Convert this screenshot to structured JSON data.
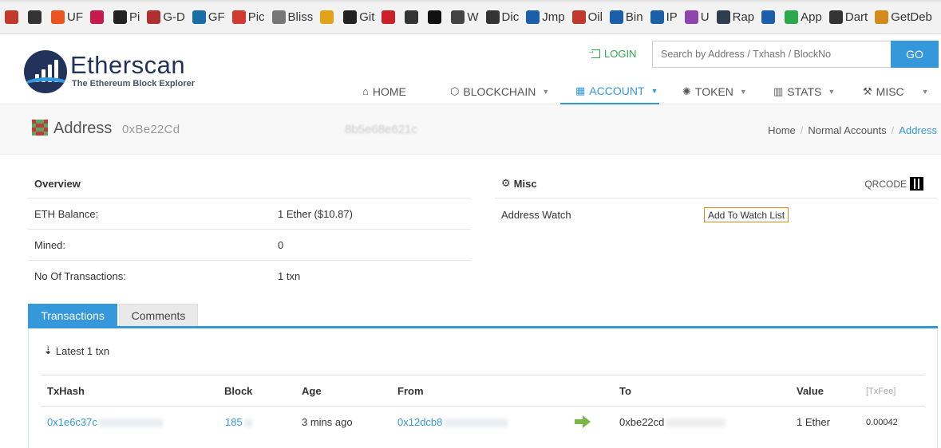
{
  "bookmarks": [
    {
      "label": "",
      "icon": "grid-icon",
      "color": "#c0392b"
    },
    {
      "label": "",
      "icon": "face-icon",
      "color": "#333333"
    },
    {
      "label": "UF",
      "icon": "ubuntu-icon",
      "color": "#e95420"
    },
    {
      "label": "",
      "icon": "raspberry-icon",
      "color": "#c51a4a"
    },
    {
      "label": "Pi",
      "icon": "penguin-icon",
      "color": "#222222"
    },
    {
      "label": "G-D",
      "icon": "book-icon",
      "color": "#b03030"
    },
    {
      "label": "GF",
      "icon": "tiki-icon",
      "color": "#1a6ea8"
    },
    {
      "label": "Pic",
      "icon": "pic-icon",
      "color": "#d03a2f"
    },
    {
      "label": "Bliss",
      "icon": "globe-icon",
      "color": "#777777"
    },
    {
      "label": "",
      "icon": "lp-icon",
      "color": "#e3a21a"
    },
    {
      "label": "Git",
      "icon": "github-icon",
      "color": "#222222"
    },
    {
      "label": "",
      "icon": "pinterest-icon",
      "color": "#cb2027"
    },
    {
      "label": "",
      "icon": "bbc-icon",
      "color": "#333333"
    },
    {
      "label": "",
      "icon": "rt-icon",
      "color": "#111111"
    },
    {
      "label": "W",
      "icon": "wiki-icon",
      "color": "#444444"
    },
    {
      "label": "Dic",
      "icon": "dict-icon",
      "color": "#333333"
    },
    {
      "label": "Jmp",
      "icon": "jump-icon",
      "color": "#1a5fa8"
    },
    {
      "label": "Oil",
      "icon": "oil-icon",
      "color": "#c0392b"
    },
    {
      "label": "Bin",
      "icon": "bin-icon",
      "color": "#1a5fa8"
    },
    {
      "label": "IP",
      "icon": "ip-icon",
      "color": "#1a5fa8"
    },
    {
      "label": "U",
      "icon": "plus-icon",
      "color": "#8e44ad"
    },
    {
      "label": "Rap",
      "icon": "rap-icon",
      "color": "#2c3e50"
    },
    {
      "label": "",
      "icon": "ht-icon",
      "color": "#1a5fa8"
    },
    {
      "label": "App",
      "icon": "play-icon",
      "color": "#2ba84a"
    },
    {
      "label": "Dart",
      "icon": "dart-icon",
      "color": "#333333"
    },
    {
      "label": "GetDeb",
      "icon": "box-icon",
      "color": "#d28a1a"
    }
  ],
  "header": {
    "logo_title": "Etherscan",
    "logo_subtitle": "The Ethereum Block Explorer",
    "login_label": "LOGIN",
    "search_placeholder": "Search by Address / Txhash / BlockNo",
    "go_label": "GO",
    "nav": [
      {
        "label": "HOME",
        "icon": "home-icon"
      },
      {
        "label": "BLOCKCHAIN",
        "icon": "cube-icon"
      },
      {
        "label": "ACCOUNT",
        "icon": "grid-icon"
      },
      {
        "label": "TOKEN",
        "icon": "token-icon"
      },
      {
        "label": "STATS",
        "icon": "chart-icon"
      },
      {
        "label": "MISC",
        "icon": "wrench-icon"
      }
    ]
  },
  "page": {
    "title": "Address",
    "address_prefix": "0xBe22Cd",
    "address_suffix": "8b5e68e621c",
    "breadcrumb": [
      "Home",
      "Normal Accounts",
      "Address"
    ]
  },
  "overview": {
    "heading": "Overview",
    "rows": [
      {
        "key": "ETH Balance:",
        "value": "1 Ether ($10.87)"
      },
      {
        "key": "Mined:",
        "value": "0"
      },
      {
        "key": "No Of Transactions:",
        "value": "1 txn"
      }
    ]
  },
  "misc": {
    "heading": "Misc",
    "qrcode_label": "QRCODE",
    "watch_label": "Address Watch",
    "watch_button": "Add To Watch List"
  },
  "tabs": [
    "Transactions",
    "Comments"
  ],
  "transactions": {
    "summary": "Latest 1 txn",
    "columns": [
      "TxHash",
      "Block",
      "Age",
      "From",
      "To",
      "Value",
      "[TxFee]"
    ],
    "rows": [
      {
        "txhash": "0x1e6c37c",
        "block": "185",
        "age": "3 mins ago",
        "from": "0x12dcb8",
        "to": "0xbe22cd",
        "value": "1 Ether",
        "fee": "0.00042"
      }
    ]
  }
}
